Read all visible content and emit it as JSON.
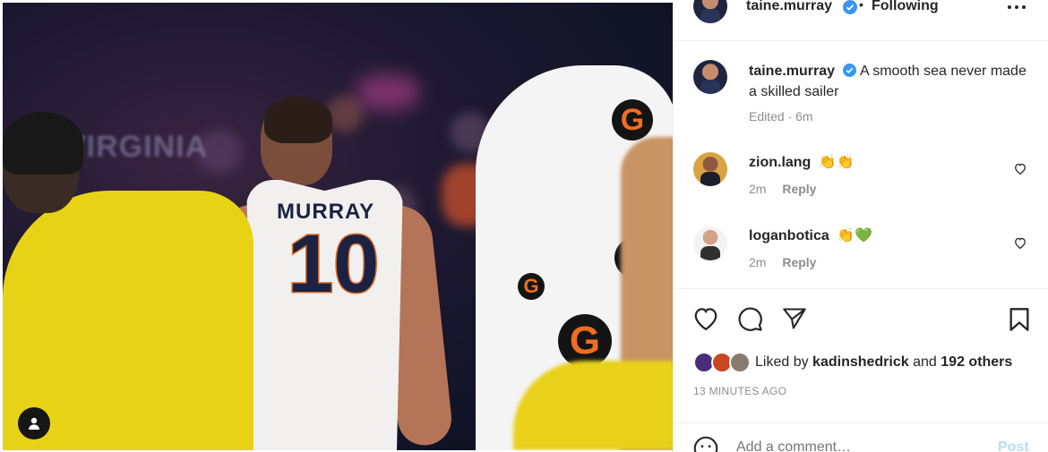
{
  "post": {
    "image_alt_jersey_name": "MURRAY",
    "image_alt_jersey_number": "10",
    "wall_text": "VIRGINIA",
    "towel_logo": "G"
  },
  "header": {
    "username": "taine.murray",
    "separator": "•",
    "follow_status": "Following",
    "more_icon": "more-horizontal-icon"
  },
  "caption": {
    "username": "taine.murray",
    "text": "A smooth sea never made a skilled sailer",
    "meta": "Edited · 6m"
  },
  "comments": [
    {
      "username": "zion.lang",
      "text": "👏👏",
      "time": "2m",
      "reply_label": "Reply"
    },
    {
      "username": "loganbotica",
      "text": "👏💚",
      "time": "2m",
      "reply_label": "Reply"
    }
  ],
  "actions": {
    "like_icon": "heart-icon",
    "comment_icon": "comment-icon",
    "share_icon": "send-icon",
    "save_icon": "bookmark-icon"
  },
  "likes": {
    "prefix": "Liked by",
    "first_user": "kadinshedrick",
    "and": "and",
    "others": "192 others"
  },
  "timestamp": "13 MINUTES AGO",
  "add_comment": {
    "placeholder": "Add a comment…",
    "post_label": "Post"
  },
  "colors": {
    "verified": "#3897f0",
    "post_button": "#b2dffc",
    "meta_text": "#8e8e8e"
  }
}
